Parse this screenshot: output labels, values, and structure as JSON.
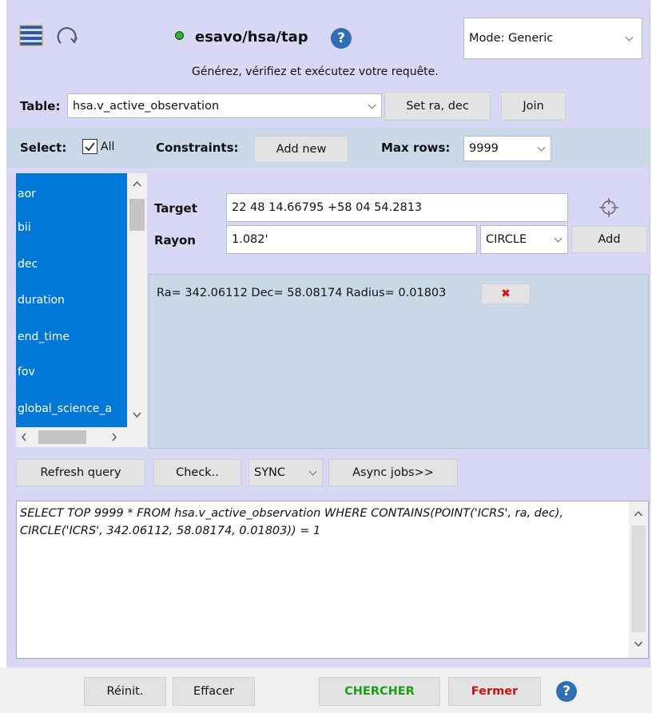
{
  "header": {
    "service_name": "esavo/hsa/tap",
    "subtitle": "Générez, vérifiez et exécutez votre requête.",
    "mode_value": "Mode: Generic",
    "status_color": "#22bb22"
  },
  "table_row": {
    "label": "Table:",
    "table_value": "hsa.v_active_observation",
    "set_radec_label": "Set ra, dec",
    "join_label": "Join"
  },
  "select_row": {
    "select_label": "Select:",
    "all_label": "All",
    "all_checked": true,
    "constraints_label": "Constraints:",
    "add_new_label": "Add new",
    "max_rows_label": "Max rows:",
    "max_rows_value": "9999"
  },
  "columns_list": {
    "items": [
      "aor",
      "bii",
      "dec",
      "duration",
      "end_time",
      "fov",
      "global_science_a"
    ]
  },
  "target_form": {
    "target_label": "Target",
    "target_value": "22 48 14.66795 +58 04 54.2813",
    "radius_label": "Rayon",
    "radius_value": "1.082'",
    "shape_value": "CIRCLE",
    "add_label": "Add"
  },
  "constraint": {
    "text": "Ra= 342.06112 Dec= 58.08174 Radius= 0.01803"
  },
  "query_toolbar": {
    "refresh_label": "Refresh query",
    "check_label": "Check..",
    "sync_value": "SYNC",
    "async_label": "Async jobs>>"
  },
  "sql": {
    "query": "SELECT TOP 9999 * FROM hsa.v_active_observation WHERE CONTAINS(POINT('ICRS', ra, dec), CIRCLE('ICRS', 342.06112, 58.08174, 0.01803)) = 1"
  },
  "footer": {
    "reset_label": "Réinit.",
    "clear_label": "Effacer",
    "search_label": "CHERCHER",
    "close_label": "Fermer",
    "search_color": "#1a9e1a",
    "close_color": "#cc1111"
  },
  "icons": {
    "help_glyph": "?",
    "delete_glyph": "✖"
  }
}
